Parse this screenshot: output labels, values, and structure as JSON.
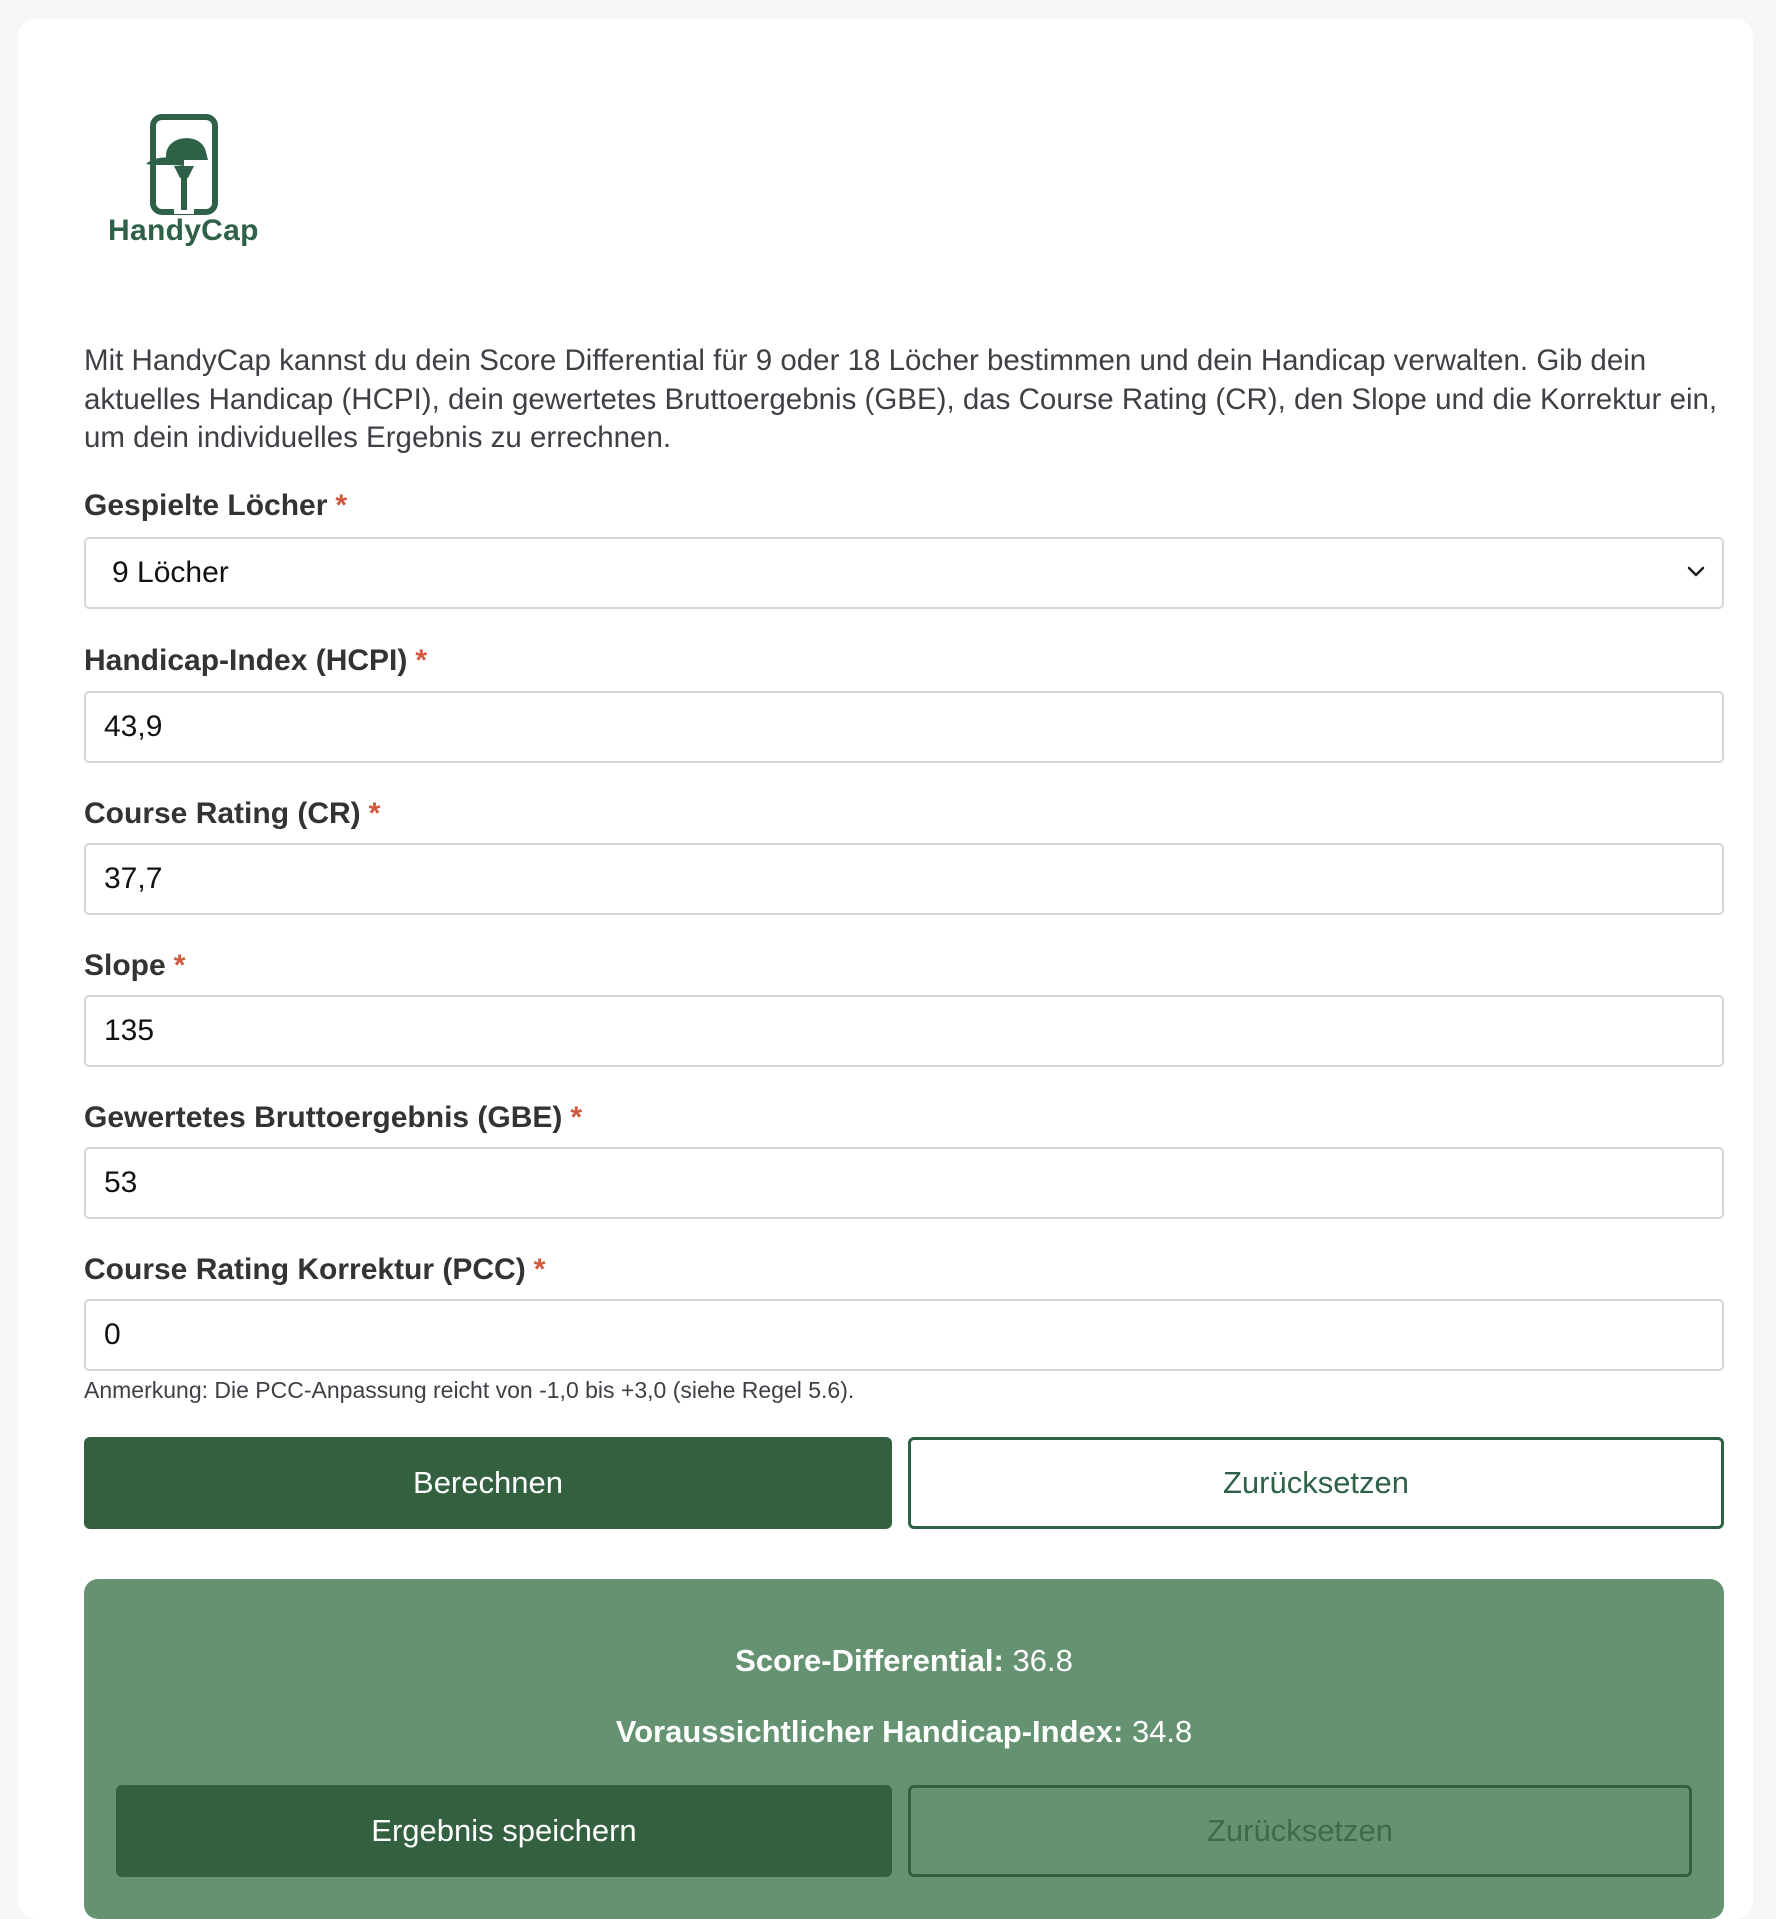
{
  "brand": {
    "name": "HandyCap",
    "color": "#2e6147"
  },
  "intro": "Mit HandyCap kannst du dein Score Differential für 9 oder 18 Löcher bestimmen und dein Handicap verwalten. Gib dein aktuelles Handicap (HCPI), dein gewertetes Bruttoergebnis (GBE), das Course Rating (CR), den Slope und die Korrektur ein, um dein individuelles Ergebnis zu errechnen.",
  "required_mark": "*",
  "fields": {
    "holes": {
      "label": "Gespielte Löcher",
      "value": "9 Löcher"
    },
    "hcpi": {
      "label": "Handicap-Index (HCPI)",
      "value": "43,9"
    },
    "cr": {
      "label": "Course Rating (CR)",
      "value": "37,7"
    },
    "slope": {
      "label": "Slope",
      "value": "135"
    },
    "gbe": {
      "label": "Gewertetes Bruttoergebnis (GBE)",
      "value": "53"
    },
    "pcc": {
      "label": "Course Rating Korrektur (PCC)",
      "value": "0"
    }
  },
  "note": "Anmerkung: Die PCC-Anpassung reicht von -1,0 bis +3,0 (siehe Regel 5.6).",
  "buttons": {
    "calculate": "Berechnen",
    "reset": "Zurücksetzen"
  },
  "result": {
    "score_label": "Score-Differential:",
    "score_value": "36.8",
    "hcpi_label": "Voraussichtlicher Handicap-Index:",
    "hcpi_value": "34.8",
    "save": "Ergebnis speichern",
    "reset": "Zurücksetzen"
  },
  "colors": {
    "primary": "#33603f",
    "result_bg": "#659271",
    "required": "#d0583c"
  },
  "icons": {
    "logo": "golf-cap-tee-icon",
    "select": "chevron-down-icon"
  }
}
